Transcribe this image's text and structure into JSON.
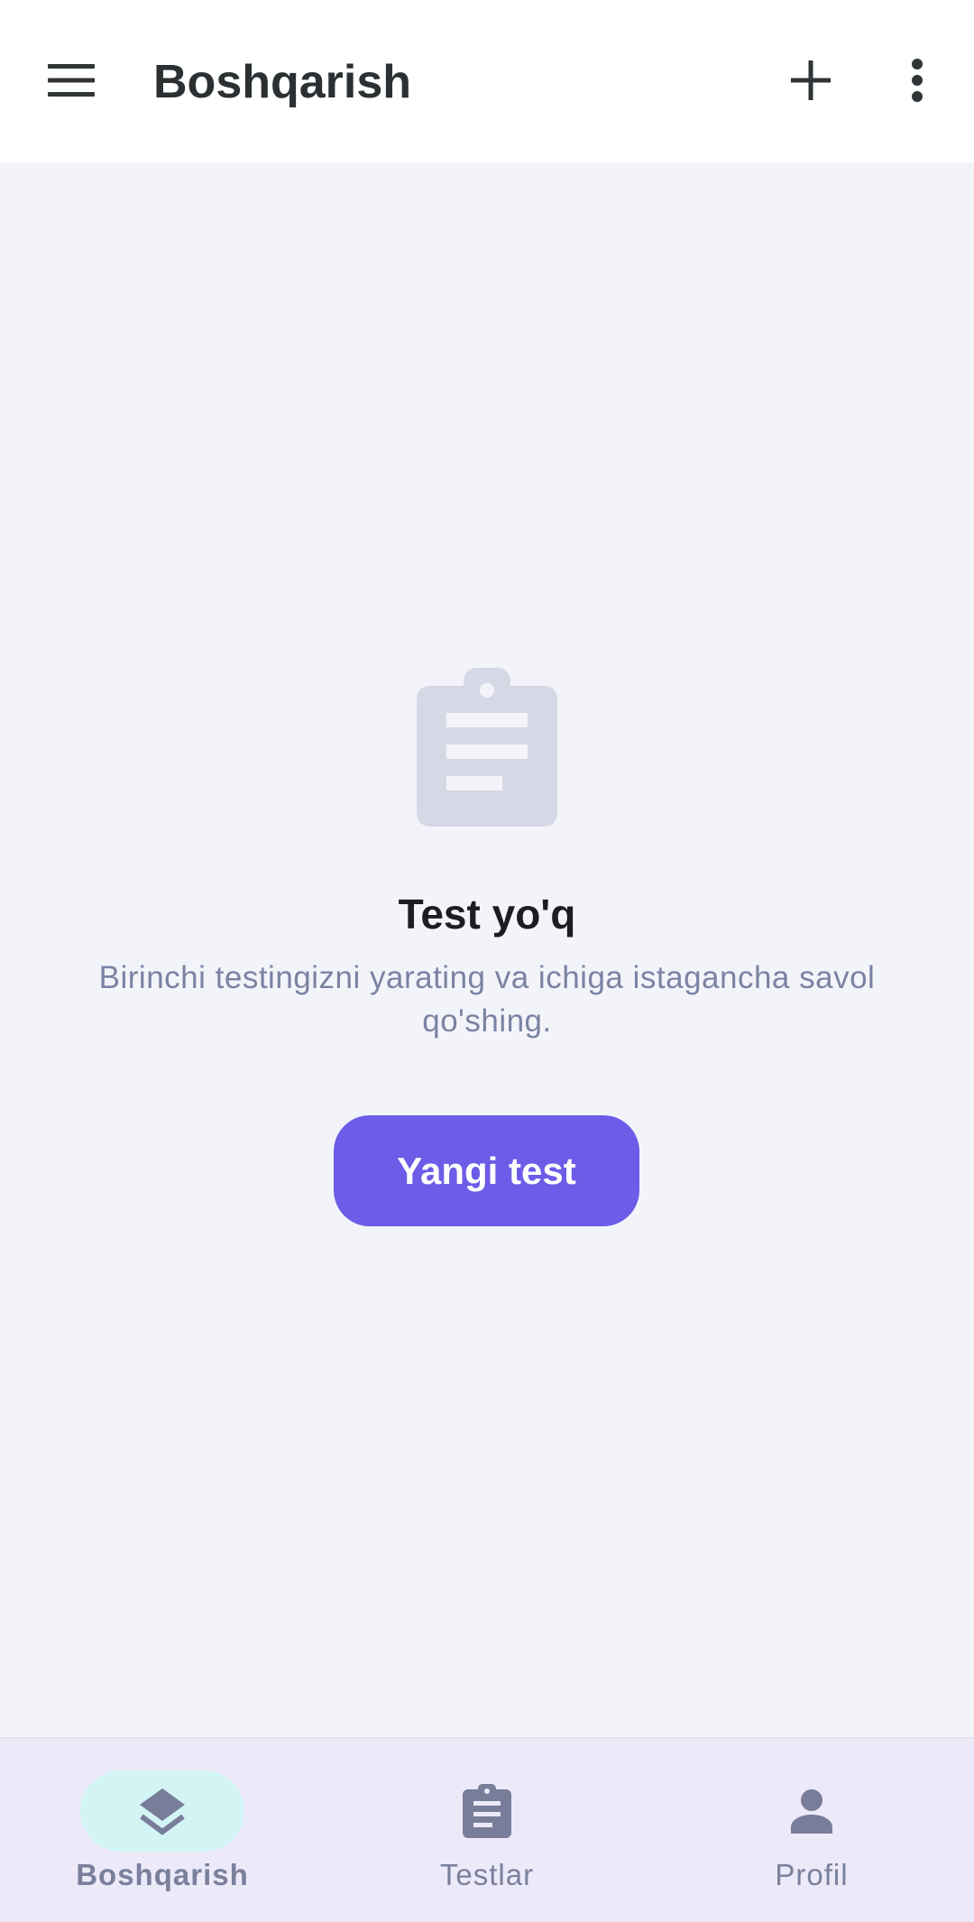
{
  "top_bar": {
    "title": "Boshqarish",
    "icons": {
      "menu": "menu-icon",
      "add": "plus-icon",
      "more": "more-vertical-icon"
    }
  },
  "empty_state": {
    "icon": "clipboard-icon",
    "title": "Test yo'q",
    "description": "Birinchi testingizni yarating va ichiga istagancha savol qo'shing.",
    "button_label": "Yangi test"
  },
  "bottom_nav": {
    "items": [
      {
        "label": "Boshqarish",
        "icon": "layers-icon",
        "active": true
      },
      {
        "label": "Testlar",
        "icon": "clipboard-icon",
        "active": false
      },
      {
        "label": "Profil",
        "icon": "person-icon",
        "active": false
      }
    ]
  },
  "colors": {
    "accent": "#6c5ce7",
    "background": "#f3f4fa",
    "nav_background": "#ece9f9",
    "active_pill": "#d3f4f5",
    "muted_text": "#7b83a3",
    "empty_icon": "#d7d8e5"
  }
}
